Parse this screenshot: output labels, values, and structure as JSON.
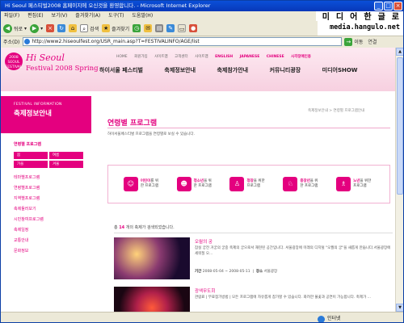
{
  "window": {
    "title": "Hi Seoul 페스티벌2008 홈페이지에 오신것을 환영합니다. - Microsoft Internet Explorer"
  },
  "menubar": {
    "items": [
      "파일(F)",
      "편집(E)",
      "보기(V)",
      "즐겨찾기(A)",
      "도구(T)",
      "도움말(H)"
    ]
  },
  "watermark": {
    "line1": "미 디 어  한 글 로",
    "line2": "media.hangulo.net"
  },
  "toolbar": {
    "back_label": "뒤로",
    "search_label": "검색",
    "favorites_label": "즐겨찾기"
  },
  "addressbar": {
    "label": "주소(D)",
    "url": "http://www2.hiseoulfest.org/USR_main.asp?T=FESTIVALINFO/AGE/list",
    "go_label": "이동",
    "links_label": "연결"
  },
  "site": {
    "logo_badge": "2008 SEOUL FESTIVAL",
    "logo_main": "Hi Seoul",
    "logo_sub": "Festival 2008 Spring",
    "top_nav": [
      "HOME",
      "회원가입",
      "사이트맵",
      "고객센터",
      "사이트맵"
    ],
    "languages": [
      "ENGLISH",
      "JAPANESE",
      "CHINESE",
      "시각장애인용"
    ],
    "main_nav": [
      "하이서울 페스티벌",
      "축제정보안내",
      "축제참가안내",
      "커뮤니티광장",
      "미디어SHOW"
    ]
  },
  "sidebar": {
    "header_en": "FESTIVAL INFORMATION",
    "header_ko": "축제정보안내",
    "active_item": "연령별 프로그램",
    "age_buttons": [
      "봄",
      "여름",
      "가을",
      "겨울"
    ],
    "items": [
      "테마별프로그램",
      "연령별프로그램",
      "지역별프로그램",
      "축제둘러보기",
      "시민참여프로그램",
      "축제일정",
      "교통안내",
      "문화정보"
    ]
  },
  "content": {
    "breadcrumb": "축제정보안내 > 연령별 프로그램안내",
    "title": "연령별 프로그램",
    "description": "하이서울페스티벌 프로그램을 연령별로 보실 수 있습니다.",
    "programs": [
      {
        "icon": "child-icon",
        "emph": "어린이",
        "label": "를 위한 프로그램"
      },
      {
        "icon": "teen-icon",
        "emph": "청소년",
        "label": "을 위한 프로그램"
      },
      {
        "icon": "adult-icon",
        "emph": "청장",
        "label": "을 위한 프로그램"
      },
      {
        "icon": "middle-age-icon",
        "emph": "중장년",
        "label": "을 위한 프로그램"
      },
      {
        "icon": "senior-icon",
        "emph": "노년",
        "label": "을 위한 프로그램"
      }
    ],
    "result_prefix": "총",
    "result_count": "14",
    "result_suffix": "개의 축제가 검색되었습니다.",
    "events": [
      {
        "title": "오월의 궁",
        "description": "잠실 궁전 거궁의 궁중 축제의 궁으로서 재현된 공간입니다. 서울광장에 미래의 디지털 \"오월의 궁\"을 새롭게 만듭니다.서울광장에 세워질 오...",
        "period_label": "기간",
        "period": "2008-05-04 ~ 2008-05-11",
        "place_label": "장소",
        "place": "서울광장"
      },
      {
        "title": "광색무도회",
        "description": "관람료 | 무료참가방법 | 모든 프로그램에 자유롭게 참가할 수 있습니다. 화려한 불꽃과 공연이 가능합니다. 축제가 ...",
        "period_label": "",
        "period": "",
        "place_label": "",
        "place": ""
      }
    ]
  },
  "statusbar": {
    "zone": "인터넷"
  }
}
